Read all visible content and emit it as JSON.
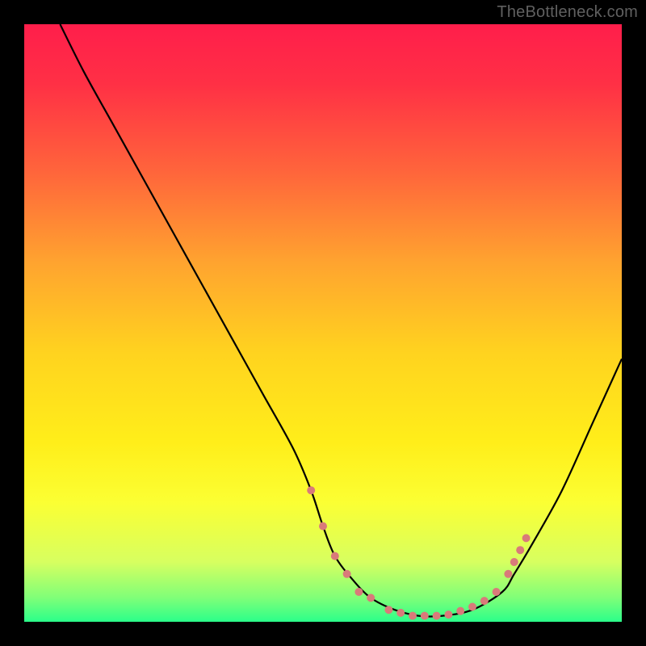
{
  "watermark": "TheBottleneck.com",
  "chart_data": {
    "type": "line",
    "title": "",
    "xlabel": "",
    "ylabel": "",
    "xlim": [
      0,
      100
    ],
    "ylim": [
      0,
      100
    ],
    "background_gradient_stops": [
      {
        "pos": 0.0,
        "color": "#ff1e4b"
      },
      {
        "pos": 0.1,
        "color": "#ff3045"
      },
      {
        "pos": 0.25,
        "color": "#ff663b"
      },
      {
        "pos": 0.4,
        "color": "#ffa42f"
      },
      {
        "pos": 0.55,
        "color": "#ffd31f"
      },
      {
        "pos": 0.7,
        "color": "#ffee1a"
      },
      {
        "pos": 0.8,
        "color": "#fbff33"
      },
      {
        "pos": 0.9,
        "color": "#d7ff60"
      },
      {
        "pos": 0.96,
        "color": "#7fff78"
      },
      {
        "pos": 1.0,
        "color": "#2bff8a"
      }
    ],
    "series": [
      {
        "name": "bottleneck-curve",
        "color": "#000000",
        "x": [
          6,
          10,
          15,
          20,
          25,
          30,
          35,
          40,
          45,
          48,
          50,
          52,
          55,
          58,
          62,
          66,
          70,
          75,
          80,
          82,
          85,
          90,
          95,
          100
        ],
        "y": [
          100,
          92,
          83,
          74,
          65,
          56,
          47,
          38,
          29,
          22,
          16,
          11,
          7,
          4,
          2,
          1,
          1,
          2,
          5,
          8,
          13,
          22,
          33,
          44
        ]
      }
    ],
    "markers": {
      "name": "highlight-dots",
      "color": "#d97a7a",
      "radius": 5,
      "points": [
        {
          "x": 48,
          "y": 22
        },
        {
          "x": 50,
          "y": 16
        },
        {
          "x": 52,
          "y": 11
        },
        {
          "x": 54,
          "y": 8
        },
        {
          "x": 56,
          "y": 5
        },
        {
          "x": 58,
          "y": 4
        },
        {
          "x": 61,
          "y": 2
        },
        {
          "x": 63,
          "y": 1.5
        },
        {
          "x": 65,
          "y": 1
        },
        {
          "x": 67,
          "y": 1
        },
        {
          "x": 69,
          "y": 1
        },
        {
          "x": 71,
          "y": 1.2
        },
        {
          "x": 73,
          "y": 1.8
        },
        {
          "x": 75,
          "y": 2.5
        },
        {
          "x": 77,
          "y": 3.5
        },
        {
          "x": 79,
          "y": 5
        },
        {
          "x": 81,
          "y": 8
        },
        {
          "x": 82,
          "y": 10
        },
        {
          "x": 83,
          "y": 12
        },
        {
          "x": 84,
          "y": 14
        }
      ]
    }
  }
}
